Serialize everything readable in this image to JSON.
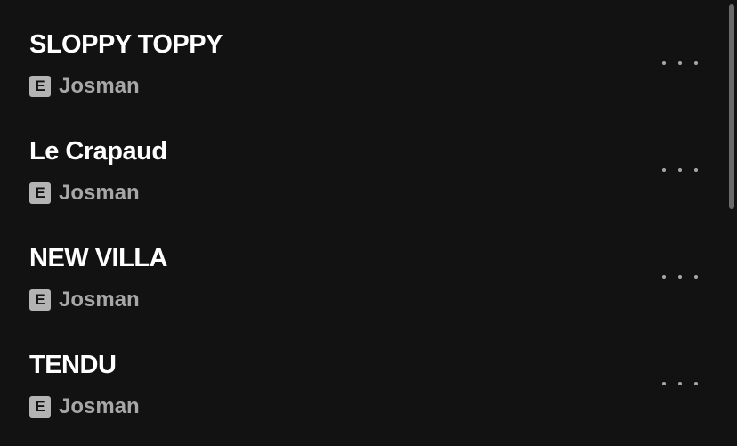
{
  "tracks": [
    {
      "title": "SLOPPY TOPPY",
      "explicit_badge": "E",
      "artist": "Josman",
      "more_icon": "more-horizontal-icon"
    },
    {
      "title": "Le Crapaud",
      "explicit_badge": "E",
      "artist": "Josman",
      "more_icon": "more-horizontal-icon"
    },
    {
      "title": "NEW VILLA",
      "explicit_badge": "E",
      "artist": "Josman",
      "more_icon": "more-horizontal-icon"
    },
    {
      "title": "TENDU",
      "explicit_badge": "E",
      "artist": "Josman",
      "more_icon": "more-horizontal-icon"
    }
  ],
  "colors": {
    "background": "#121212",
    "title": "#ffffff",
    "secondary_text": "#a7a7a7",
    "badge": "#b3b3b3"
  }
}
